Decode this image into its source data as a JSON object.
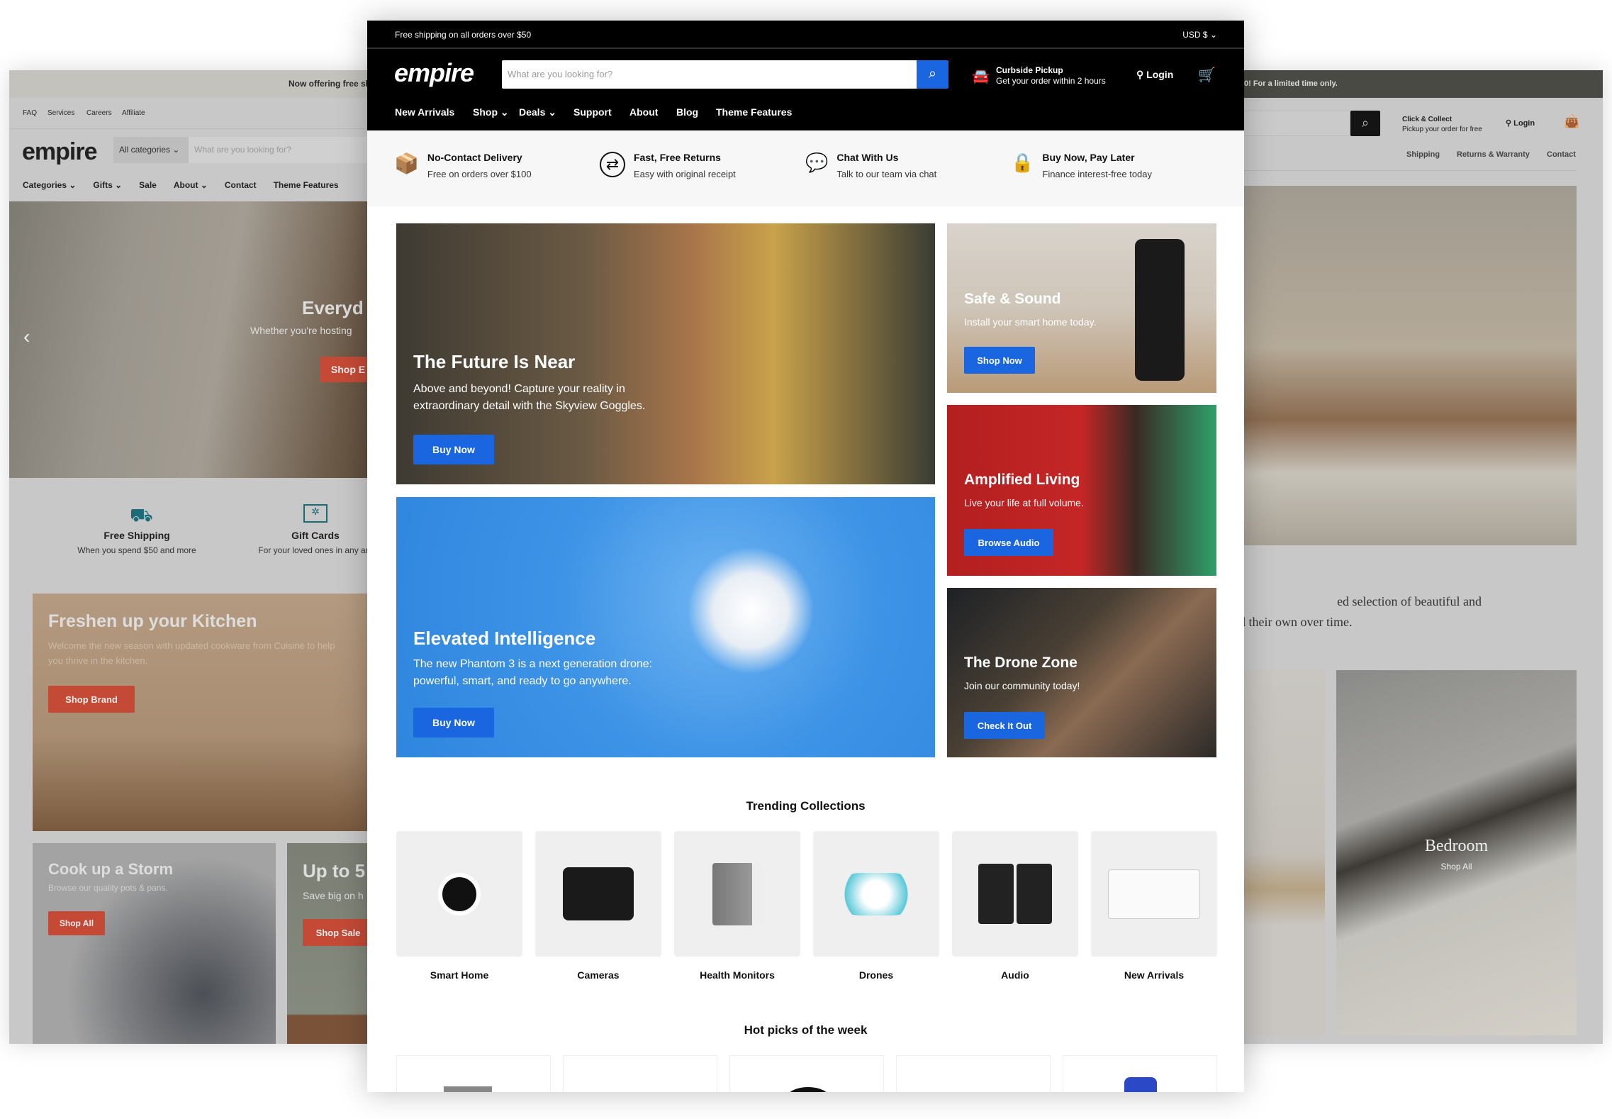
{
  "left_page": {
    "announcement": "Now offering free sh",
    "util_links": [
      "FAQ",
      "Services",
      "Careers",
      "Affiliate"
    ],
    "logo": "empire",
    "category_select": "All categories",
    "search_placeholder": "What are you looking for?",
    "nav": [
      "Categories",
      "Gifts",
      "Sale",
      "About",
      "Contact",
      "Theme Features"
    ],
    "hero": {
      "title": "Everyd",
      "subtitle": "Whether you're hosting",
      "button": "Shop E"
    },
    "features": [
      {
        "title": "Free Shipping",
        "sub": "When you spend $50 and more"
      },
      {
        "title": "Gift Cards",
        "sub": "For your loved ones in any am"
      }
    ],
    "kitchen": {
      "title": "Freshen up your Kitchen",
      "sub": "Welcome the new season with updated cookware from Cuisine to help you thrive in the kitchen.",
      "button": "Shop Brand"
    },
    "storm": {
      "title": "Cook up a Storm",
      "sub": "Browse our quality pots & pans.",
      "button": "Shop All"
    },
    "sale": {
      "title": "Up to 5",
      "sub": "Save big on h",
      "button": "Shop Sale"
    },
    "accent": "#c44a36"
  },
  "right_page": {
    "announcement": "0! For a limited time only.",
    "click_collect": {
      "title": "Click & Collect",
      "sub": "Pickup your order for free"
    },
    "login": "Login",
    "links": [
      "Shipping",
      "Returns & Warranty",
      "Contact"
    ],
    "text_lines": [
      "ed selection of beautiful and",
      "d their own over time."
    ],
    "bedroom": {
      "title": "Bedroom",
      "link": "Shop All"
    }
  },
  "main": {
    "topbar": {
      "shipping": "Free shipping on all orders over $50",
      "currency": "USD $"
    },
    "logo": "empire",
    "search_placeholder": "What are you looking for?",
    "pickup": {
      "title": "Curbside Pickup",
      "sub": "Get your order within 2 hours"
    },
    "login": "Login",
    "nav": [
      "New Arrivals",
      "Shop",
      "Deals",
      "Support",
      "About",
      "Blog",
      "Theme Features"
    ],
    "features": [
      {
        "title": "No-Contact Delivery",
        "sub": "Free on orders over $100",
        "icon": "box-hands-icon"
      },
      {
        "title": "Fast, Free Returns",
        "sub": "Easy with original receipt",
        "icon": "returns-icon"
      },
      {
        "title": "Chat With Us",
        "sub": "Talk to our team via chat",
        "icon": "chat-icon"
      },
      {
        "title": "Buy Now, Pay Later",
        "sub": "Finance interest-free today",
        "icon": "finance-lock-icon"
      }
    ],
    "hero": [
      {
        "title": "The Future Is Near",
        "sub": "Above and beyond! Capture your reality in extraordinary detail with the Skyview Goggles.",
        "button": "Buy Now"
      },
      {
        "title": "Elevated Intelligence",
        "sub": "The new Phantom 3 is a next generation drone: powerful, smart, and ready to go anywhere.",
        "button": "Buy Now"
      },
      {
        "title": "Safe & Sound",
        "sub": "Install your smart home today.",
        "button": "Shop Now"
      },
      {
        "title": "Amplified Living",
        "sub": "Live your life at full volume.",
        "button": "Browse Audio"
      },
      {
        "title": "The Drone Zone",
        "sub": "Join our community today!",
        "button": "Check It Out"
      }
    ],
    "trending_title": "Trending Collections",
    "trending": [
      "Smart Home",
      "Cameras",
      "Health Monitors",
      "Drones",
      "Audio",
      "New Arrivals"
    ],
    "hot_title": "Hot picks of the week",
    "accent": "#1a66e0"
  }
}
